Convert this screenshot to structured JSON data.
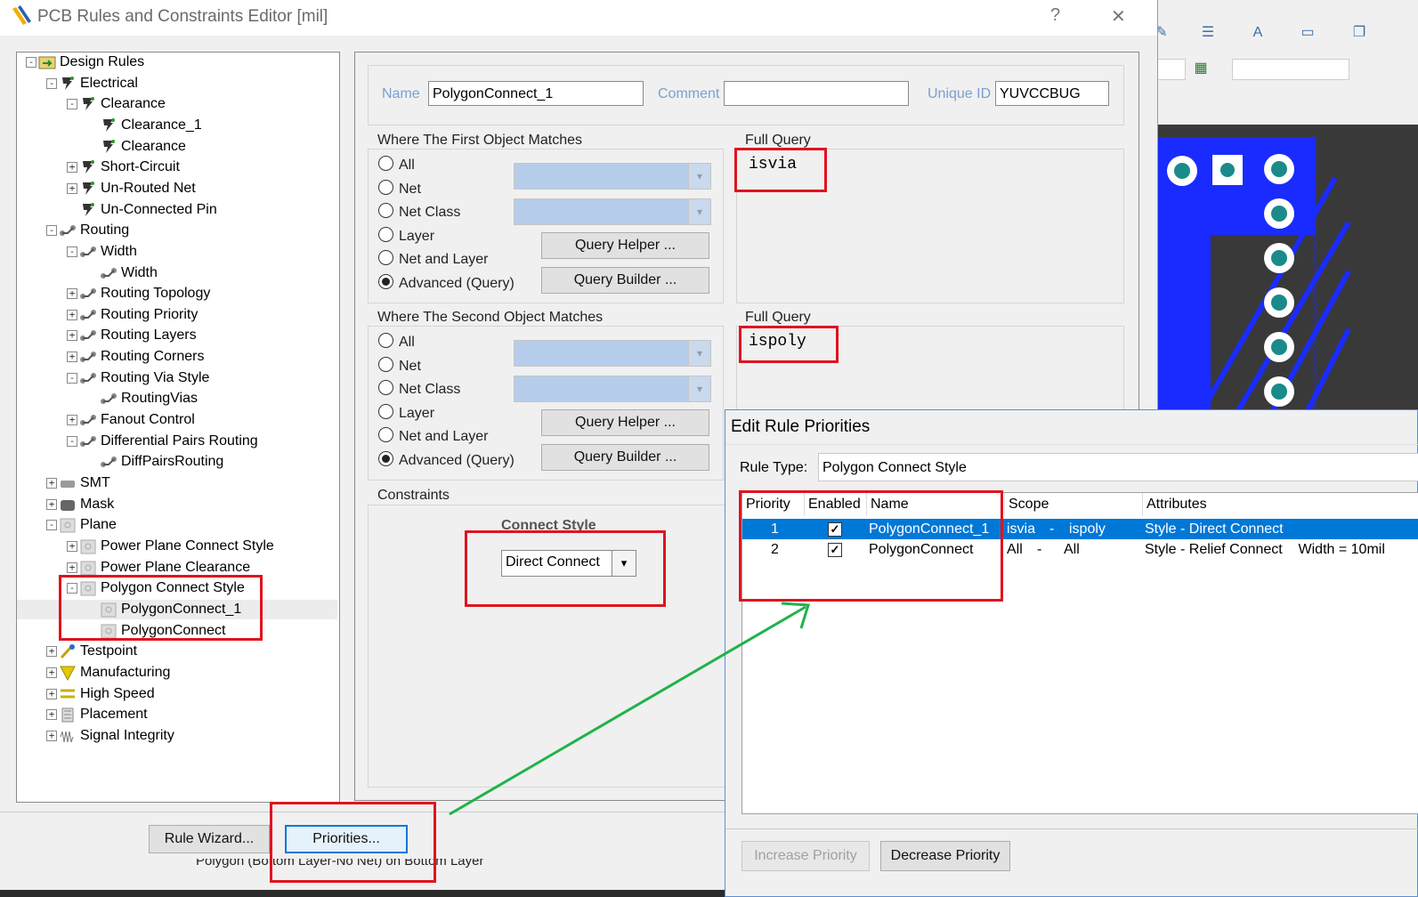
{
  "main_dialog": {
    "title": "PCB Rules and Constraints Editor [mil]",
    "help_btn": "?",
    "close_btn": "✕"
  },
  "tree": {
    "items": [
      {
        "label": "Design Rules"
      },
      {
        "label": "Electrical"
      },
      {
        "label": "Clearance"
      },
      {
        "label": "Clearance_1"
      },
      {
        "label": "Clearance"
      },
      {
        "label": "Short-Circuit"
      },
      {
        "label": "Un-Routed Net"
      },
      {
        "label": "Un-Connected Pin"
      },
      {
        "label": "Routing"
      },
      {
        "label": "Width"
      },
      {
        "label": "Width"
      },
      {
        "label": "Routing Topology"
      },
      {
        "label": "Routing Priority"
      },
      {
        "label": "Routing Layers"
      },
      {
        "label": "Routing Corners"
      },
      {
        "label": "Routing Via Style"
      },
      {
        "label": "RoutingVias"
      },
      {
        "label": "Fanout Control"
      },
      {
        "label": "Differential Pairs Routing"
      },
      {
        "label": "DiffPairsRouting"
      },
      {
        "label": "SMT"
      },
      {
        "label": "Mask"
      },
      {
        "label": "Plane"
      },
      {
        "label": "Power Plane Connect Style"
      },
      {
        "label": "Power Plane Clearance"
      },
      {
        "label": "Polygon Connect Style"
      },
      {
        "label": "PolygonConnect_1"
      },
      {
        "label": "PolygonConnect"
      },
      {
        "label": "Testpoint"
      },
      {
        "label": "Manufacturing"
      },
      {
        "label": "High Speed"
      },
      {
        "label": "Placement"
      },
      {
        "label": "Signal Integrity"
      }
    ]
  },
  "rule": {
    "name_label": "Name",
    "name_value": "PolygonConnect_1",
    "comment_label": "Comment",
    "comment_value": "",
    "uid_label": "Unique ID",
    "uid_value": "YUVCCBUG"
  },
  "first_match": {
    "title": "Where The First Object Matches",
    "options": [
      "All",
      "Net",
      "Net Class",
      "Layer",
      "Net and Layer",
      "Advanced (Query)"
    ],
    "selected": "Advanced (Query)",
    "query_helper": "Query Helper ...",
    "query_builder": "Query Builder ...",
    "full_query_title": "Full Query",
    "full_query": "isvia"
  },
  "second_match": {
    "title": "Where The Second Object Matches",
    "options": [
      "All",
      "Net",
      "Net Class",
      "Layer",
      "Net and Layer",
      "Advanced (Query)"
    ],
    "selected": "Advanced (Query)",
    "query_helper": "Query Helper ...",
    "query_builder": "Query Builder ...",
    "full_query_title": "Full Query",
    "full_query": "ispoly"
  },
  "constraints": {
    "title": "Constraints",
    "connect_style_label": "Connect Style",
    "connect_style_value": "Direct Connect"
  },
  "bottom": {
    "rule_wizard": "Rule Wizard...",
    "priorities": "Priorities...",
    "status_text": "Polygon  (Bottom Layer-No Net)  on Bottom Layer"
  },
  "priorities_dialog": {
    "title": "Edit Rule Priorities",
    "rule_type_label": "Rule Type:",
    "rule_type_value": "Polygon Connect Style",
    "columns": [
      "Priority",
      "Enabled",
      "Name",
      "Scope",
      "Attributes"
    ],
    "rows": [
      {
        "priority": "1",
        "enabled": true,
        "name": "PolygonConnect_1",
        "scope_a": "isvia",
        "scope_sep": "-",
        "scope_b": "ispoly",
        "attributes": "Style - Direct Connect"
      },
      {
        "priority": "2",
        "enabled": true,
        "name": "PolygonConnect",
        "scope_a": "All",
        "scope_sep": "-",
        "scope_b": "All",
        "attributes": "Style - Relief Connect    Width = 10mil"
      }
    ],
    "increase_btn": "Increase Priority",
    "decrease_btn": "Decrease Priority"
  },
  "colors": {
    "annotation_red": "#e0141e",
    "annotation_arrow": "#1fb34a",
    "selection_blue": "#0078d7",
    "pcb_blue": "#1a2bff",
    "pad_teal": "#1a8a8a"
  }
}
